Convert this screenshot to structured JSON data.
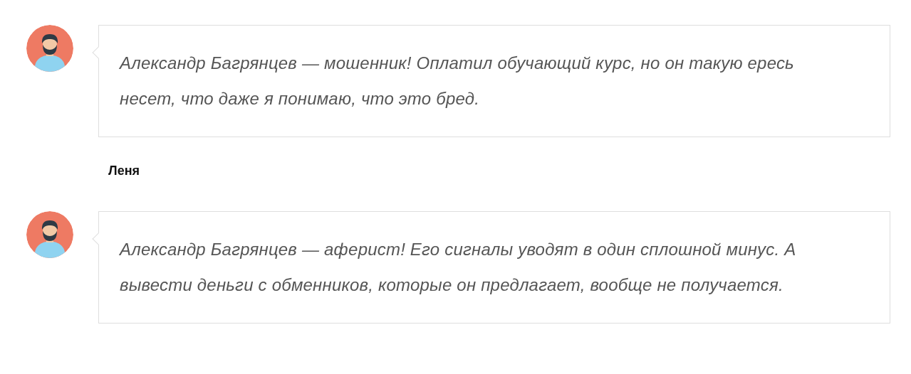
{
  "comments": [
    {
      "text": "Александр Багрянцев — мошенник! Оплатил обучающий курс, но он такую ересь несет, что даже я понимаю, что это бред."
    },
    {
      "author": "Леня",
      "text": "Александр Багрянцев — аферист! Его сигналы уводят в один сплошной минус. А вывести деньги с обменников, которые он предлагает, вообще не получается."
    }
  ]
}
